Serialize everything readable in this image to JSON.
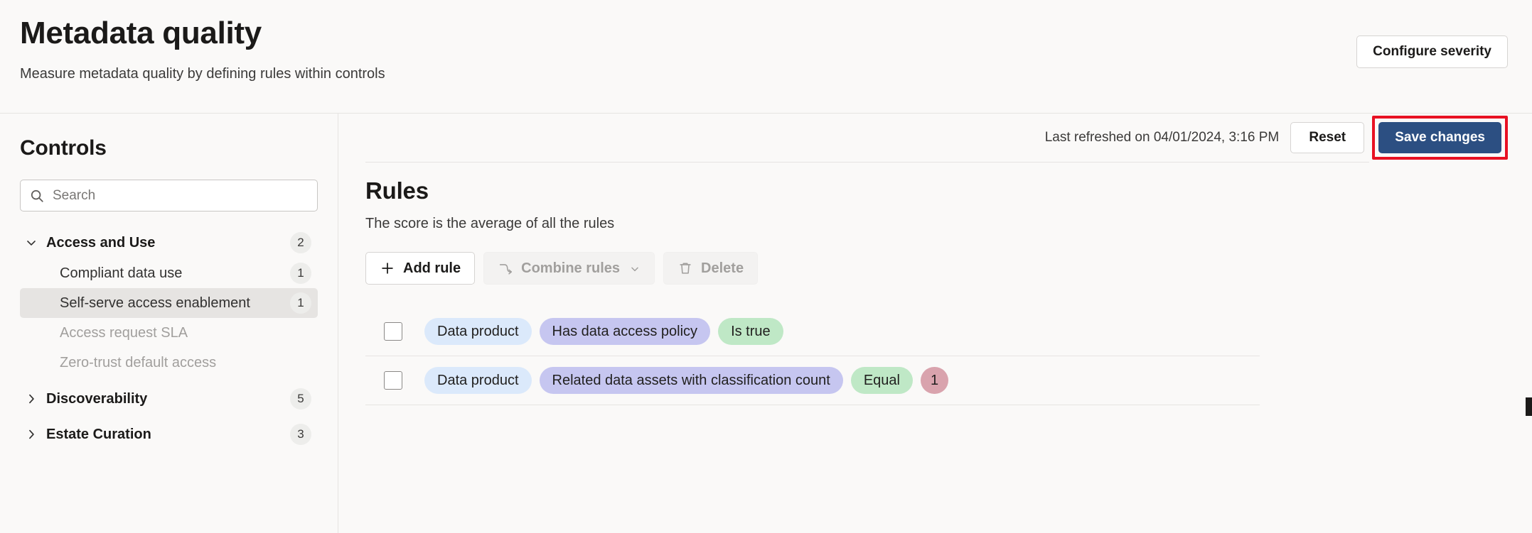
{
  "header": {
    "title": "Metadata quality",
    "subtitle": "Measure metadata quality by defining rules within controls",
    "configure_severity_label": "Configure severity"
  },
  "sidebar": {
    "title": "Controls",
    "search": {
      "placeholder": "Search",
      "value": "",
      "icon": "search-icon"
    },
    "groups": [
      {
        "label": "Access and Use",
        "count": "2",
        "expanded": true,
        "chevron": "chevron-down-icon",
        "children": [
          {
            "label": "Compliant data use",
            "count": "1",
            "selected": false,
            "disabled": false
          },
          {
            "label": "Self-serve access enablement",
            "count": "1",
            "selected": true,
            "disabled": false
          },
          {
            "label": "Access request SLA",
            "count": "",
            "selected": false,
            "disabled": true
          },
          {
            "label": "Zero-trust default access",
            "count": "",
            "selected": false,
            "disabled": true
          }
        ]
      },
      {
        "label": "Discoverability",
        "count": "5",
        "expanded": false,
        "chevron": "chevron-right-icon",
        "children": []
      },
      {
        "label": "Estate Curation",
        "count": "3",
        "expanded": false,
        "chevron": "chevron-right-icon",
        "children": []
      }
    ]
  },
  "toolbar": {
    "last_refreshed": "Last refreshed on 04/01/2024, 3:16 PM",
    "reset_label": "Reset",
    "save_label": "Save changes",
    "save_highlighted": true,
    "highlight_color": "#e81123"
  },
  "rules": {
    "title": "Rules",
    "subtitle": "The score is the average of all the rules",
    "actions": [
      {
        "label": "Add rule",
        "icon": "plus-icon",
        "disabled": false,
        "caret": false
      },
      {
        "label": "Combine rules",
        "icon": "combine-icon",
        "disabled": true,
        "caret": true
      },
      {
        "label": "Delete",
        "icon": "trash-icon",
        "disabled": true,
        "caret": false
      }
    ],
    "rows": [
      {
        "checked": false,
        "pills": [
          {
            "text": "Data product",
            "kind": "entity"
          },
          {
            "text": "Has data access policy",
            "kind": "attr"
          },
          {
            "text": "Is true",
            "kind": "op"
          }
        ]
      },
      {
        "checked": false,
        "pills": [
          {
            "text": "Data product",
            "kind": "entity"
          },
          {
            "text": "Related data assets with classification count",
            "kind": "attr"
          },
          {
            "text": "Equal",
            "kind": "op"
          },
          {
            "text": "1",
            "kind": "value"
          }
        ]
      }
    ]
  },
  "colors": {
    "accent": "#2c4f82",
    "pill_entity": "#dbe9fb",
    "pill_attr": "#c6c6f0",
    "pill_op": "#bfe8c6",
    "pill_value": "#d9a3ad",
    "page_bg": "#faf9f8"
  }
}
